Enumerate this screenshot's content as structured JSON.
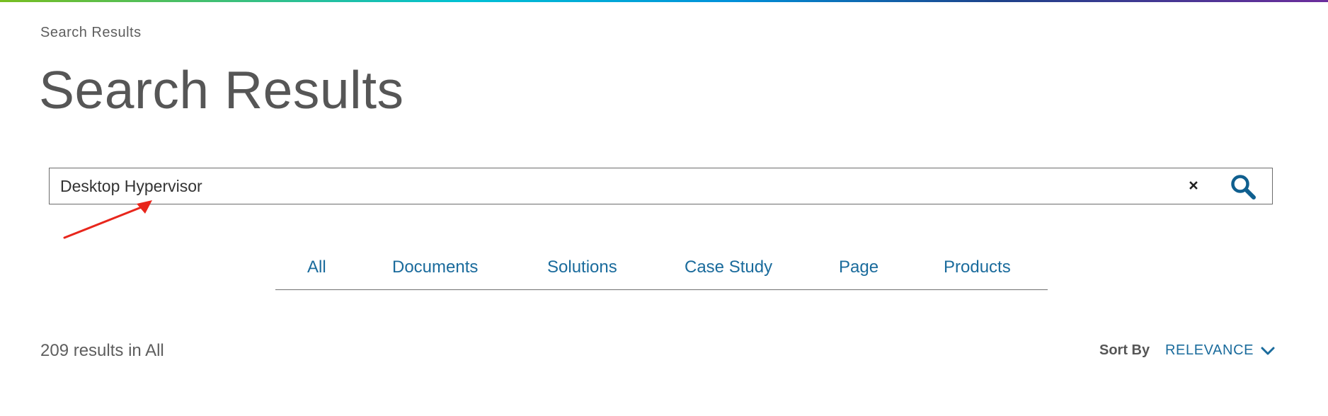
{
  "breadcrumb": "Search Results",
  "page": {
    "title": "Search Results"
  },
  "search": {
    "value": "Desktop Hypervisor",
    "clear_icon": "close-icon",
    "submit_icon": "search-icon"
  },
  "tabs": [
    {
      "label": "All"
    },
    {
      "label": "Documents"
    },
    {
      "label": "Solutions"
    },
    {
      "label": "Case Study"
    },
    {
      "label": "Page"
    },
    {
      "label": "Products"
    }
  ],
  "results": {
    "count_text": "209 results in All"
  },
  "sort": {
    "label": "Sort By",
    "selected": "RELEVANCE",
    "icon": "chevron-down-icon"
  },
  "colors": {
    "link": "#1a6b9c",
    "text": "#565656",
    "annotation": "#e8261c",
    "icon": "#0f5f8f"
  }
}
